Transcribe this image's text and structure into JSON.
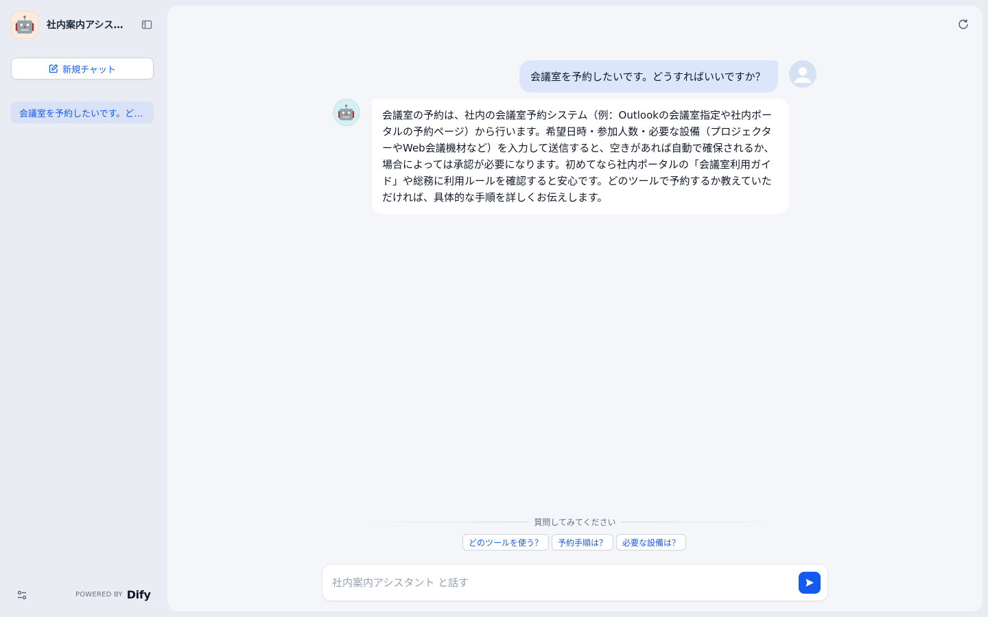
{
  "app": {
    "title": "社内案内アシスタント",
    "avatar_emoji": "🤖",
    "avatar_bg": "#ffeadb"
  },
  "sidebar": {
    "new_chat_label": "新規チャット",
    "conversations": [
      {
        "label": "会議室を予約したいです。どうすればいいですか？",
        "active": true
      }
    ],
    "powered_by_label": "POWERED BY",
    "brand_name": "Dify"
  },
  "chat": {
    "messages": [
      {
        "role": "user",
        "text": "会議室を予約したいです。どうすればいいですか？"
      },
      {
        "role": "assistant",
        "avatar_emoji": "🤖",
        "text": "会議室の予約は、社内の会議室予約システム（例：Outlookの会議室指定や社内ポータルの予約ページ）から行います。希望日時・参加人数・必要な設備（プロジェクターやWeb会議機材など）を入力して送信すると、空きがあれば自動で確保されるか、場合によっては承認が必要になります。初めてなら社内ポータルの「会議室利用ガイド」や総務に利用ルールを確認すると安心です。どのツールで予約するか教えていただければ、具体的な手順を詳しくお伝えします。"
      }
    ],
    "suggestions_title": "質問してみてください",
    "suggestions": [
      "どのツールを使う？",
      "予約手順は？",
      "必要な設備は？"
    ],
    "input": {
      "value": "",
      "placeholder": "社内案内アシスタント と話す"
    }
  },
  "icons": {
    "collapse": "sidebar-collapse-icon",
    "new_chat": "edit-icon",
    "reset": "refresh-icon",
    "settings": "sliders-icon",
    "send": "send-icon",
    "user_avatar": "user-icon"
  },
  "colors": {
    "accent": "#155aef",
    "user_bubble": "#dbe6fd",
    "sidebar_bg": "#e9ecf3",
    "active_conv_bg": "#d8e1f5"
  }
}
